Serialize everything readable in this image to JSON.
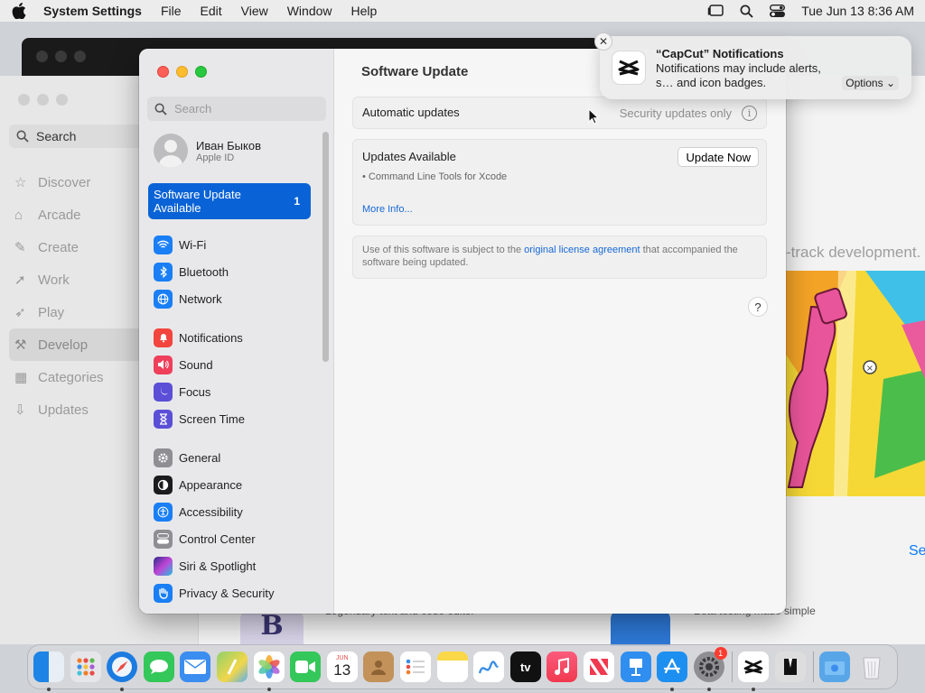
{
  "menubar": {
    "app_name": "System Settings",
    "menus": [
      "File",
      "Edit",
      "View",
      "Window",
      "Help"
    ],
    "datetime": "Tue Jun 13  8:36 AM"
  },
  "appstore": {
    "search_label": "Search",
    "nav": [
      "Discover",
      "Arcade",
      "Create",
      "Work",
      "Play",
      "Develop",
      "Categories",
      "Updates"
    ],
    "active_nav": "Develop",
    "hero_text": "-track development.",
    "see_all": "Se",
    "bottom_left": "Legendary text and code editor",
    "bottom_right": "Beta testing made simple"
  },
  "settings": {
    "search_placeholder": "Search",
    "account": {
      "name": "Иван Быков",
      "sub": "Apple ID"
    },
    "update_card": {
      "label": "Software Update Available",
      "badge": "1"
    },
    "nav_groups": [
      [
        {
          "label": "Wi-Fi",
          "color": "#1a7ff5",
          "icon": "wifi-icon"
        },
        {
          "label": "Bluetooth",
          "color": "#1a7ff5",
          "icon": "bluetooth-icon"
        },
        {
          "label": "Network",
          "color": "#1a7ff5",
          "icon": "globe-icon"
        }
      ],
      [
        {
          "label": "Notifications",
          "color": "#f2453e",
          "icon": "bell-icon"
        },
        {
          "label": "Sound",
          "color": "#ef3f5b",
          "icon": "speaker-icon"
        },
        {
          "label": "Focus",
          "color": "#5a4fd6",
          "icon": "moon-icon"
        },
        {
          "label": "Screen Time",
          "color": "#5a4fd6",
          "icon": "hourglass-icon"
        }
      ],
      [
        {
          "label": "General",
          "color": "#8e8e93",
          "icon": "gear-icon"
        },
        {
          "label": "Appearance",
          "color": "#1c1c1e",
          "icon": "appearance-icon"
        },
        {
          "label": "Accessibility",
          "color": "#1a7ff5",
          "icon": "accessibility-icon"
        },
        {
          "label": "Control Center",
          "color": "#8e8e93",
          "icon": "control-center-icon"
        },
        {
          "label": "Siri & Spotlight",
          "color": "#c044d6",
          "icon": "siri-icon"
        },
        {
          "label": "Privacy & Security",
          "color": "#1a7ff5",
          "icon": "hand-icon"
        }
      ]
    ],
    "title": "Software Update",
    "automatic_label": "Automatic updates",
    "automatic_value": "Security updates only",
    "updates_title": "Updates Available",
    "update_item": "• Command Line Tools for Xcode",
    "update_button": "Update Now",
    "more_info": "More Info...",
    "license_prefix": "Use of this software is subject to the ",
    "license_link": "original license agreement",
    "license_suffix": " that accompanied the software being updated.",
    "help": "?"
  },
  "notification": {
    "title": "“CapCut” Notifications",
    "body": "Notifications may include alerts, s… and icon badges.",
    "options": "Options"
  },
  "dock": {
    "calendar_month": "JUN",
    "calendar_day": "13",
    "tv_label": "tv",
    "settings_badge": "1"
  }
}
